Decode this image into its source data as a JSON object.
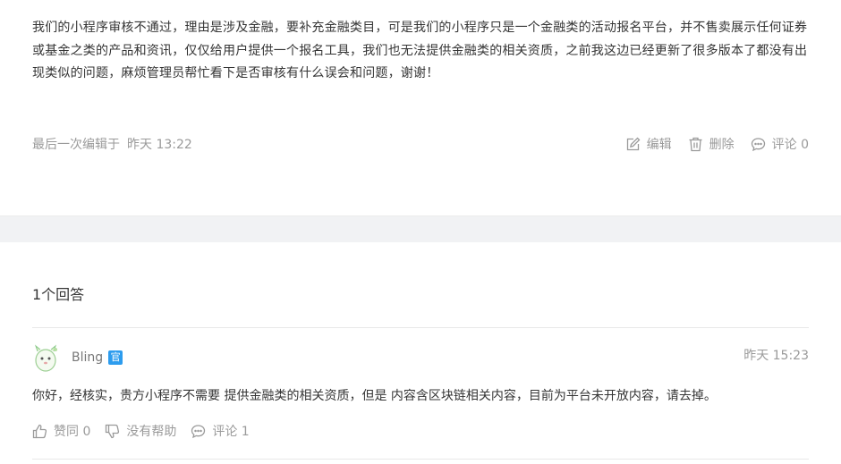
{
  "question": {
    "text": "我们的小程序审核不通过，理由是涉及金融，要补充金融类目，可是我们的小程序只是一个金融类的活动报名平台，并不售卖展示任何证券或基金之类的产品和资讯，仅仅给用户提供一个报名工具，我们也无法提供金融类的相关资质，之前我这边已经更新了很多版本了都没有出现类似的问题，麻烦管理员帮忙看下是否审核有什么误会和问题，谢谢！",
    "edited_label": "最后一次编辑于",
    "edited_time": "昨天 13:22",
    "actions": {
      "edit": "编辑",
      "delete": "删除",
      "comment": "评论 0"
    }
  },
  "answers": {
    "count_title": "1个回答",
    "items": [
      {
        "author": "Bling",
        "badge": "官",
        "time": "昨天 15:23",
        "text": "你好，经核实，贵方小程序不需要 提供金融类的相关资质，但是 内容含区块链相关内容，目前为平台未开放内容，请去掉。",
        "like_label": "赞同 0",
        "unhelpful_label": "没有帮助",
        "comment_label": "评论 1"
      }
    ]
  },
  "icons": {
    "edit": "edit-icon",
    "delete": "trash-icon",
    "comment": "comment-icon",
    "like": "thumbs-up-icon",
    "unhelpful": "thumbs-down-icon"
  },
  "colors": {
    "badge": "#2d9cee",
    "text": "#353535",
    "meta": "#9a9a9a",
    "band": "#f1f2f4"
  }
}
